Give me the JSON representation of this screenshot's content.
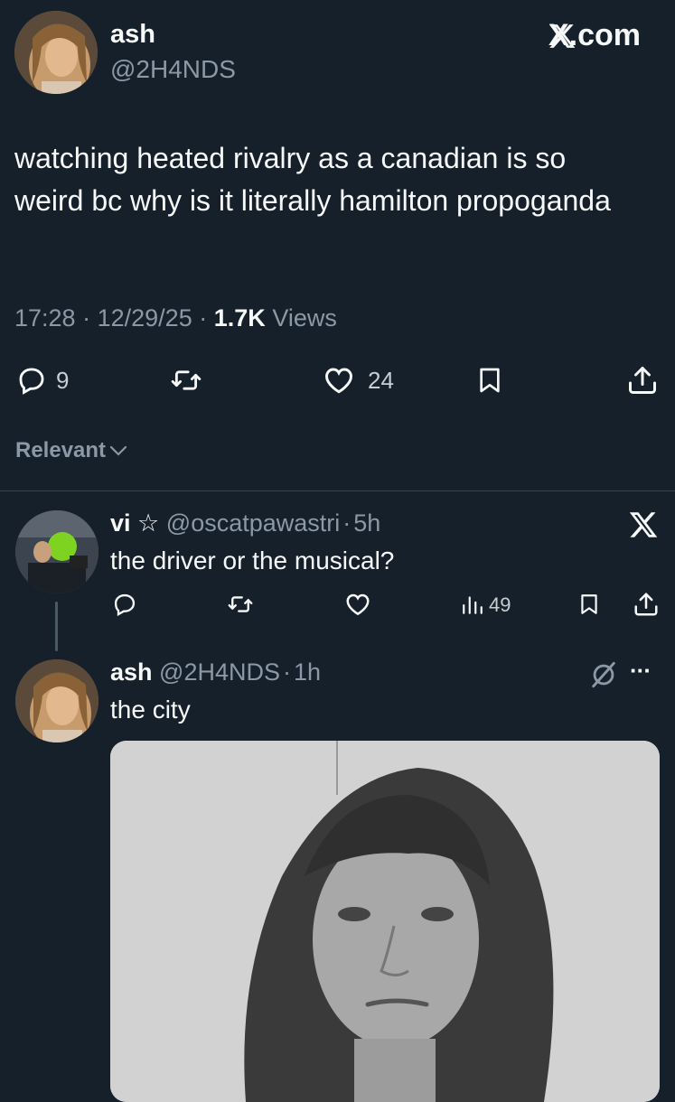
{
  "post": {
    "author_name": "ash",
    "author_handle": "@2H4NDS",
    "brand": "X.com",
    "text": "watching heated rivalry as a canadian is so weird bc why is it literally hamilton propoganda",
    "time": "17:28",
    "date": "12/29/25",
    "views_count": "1.7K",
    "views_label": "Views",
    "sep": "·",
    "actions": {
      "replies": "9",
      "likes": "24"
    }
  },
  "sort": {
    "label": "Relevant"
  },
  "reply1": {
    "name": "vi",
    "star": "☆",
    "handle": "@oscatpawastri",
    "sep": "·",
    "time": "5h",
    "text": "the driver or the musical?",
    "views": "49"
  },
  "reply2": {
    "name": "ash",
    "handle": "@2H4NDS",
    "sep": "·",
    "time": "1h",
    "text": "the city",
    "more": "···"
  },
  "colors": {
    "background": "#15202b",
    "text": "#f7f9f9",
    "muted": "#8b98a5",
    "divider": "#38444d"
  },
  "icons": [
    "reply-icon",
    "retweet-icon",
    "like-icon",
    "bookmark-icon",
    "share-icon",
    "views-icon",
    "x-logo-icon",
    "mute-icon",
    "more-icon",
    "chevron-down-icon"
  ]
}
